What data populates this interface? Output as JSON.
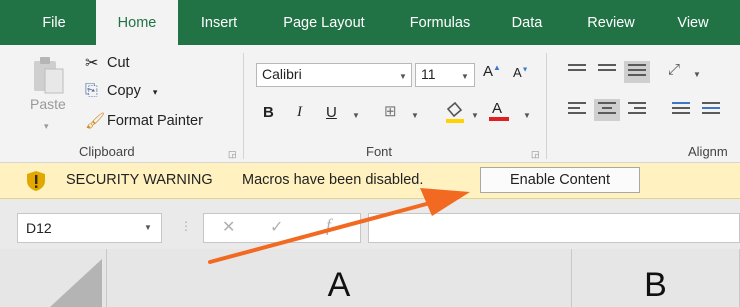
{
  "ribbon_tabs": [
    {
      "label": "File",
      "active": false
    },
    {
      "label": "Home",
      "active": true
    },
    {
      "label": "Insert",
      "active": false
    },
    {
      "label": "Page Layout",
      "active": false
    },
    {
      "label": "Formulas",
      "active": false
    },
    {
      "label": "Data",
      "active": false
    },
    {
      "label": "Review",
      "active": false
    },
    {
      "label": "View",
      "active": false
    }
  ],
  "clipboard": {
    "paste_label": "Paste",
    "cut_label": "Cut",
    "copy_label": "Copy",
    "format_painter_label": "Format Painter",
    "group_label": "Clipboard"
  },
  "font": {
    "font_name": "Calibri",
    "font_size": "11",
    "bold": "B",
    "italic": "I",
    "underline": "U",
    "font_color_glyph": "A",
    "grow_font_glyph": "A",
    "shrink_font_glyph": "A",
    "group_label": "Font"
  },
  "alignment": {
    "group_label": "Alignm"
  },
  "security_bar": {
    "title": "SECURITY WARNING",
    "message": "Macros have been disabled.",
    "button_label": "Enable Content",
    "icon": "warning-shield-icon"
  },
  "formula_bar": {
    "name_box_value": "D12",
    "cancel_glyph": "✕",
    "enter_glyph": "✓",
    "function_glyph": "f",
    "formula_value": ""
  },
  "columns": [
    "A",
    "B"
  ],
  "colors": {
    "ribbon_green": "#217346",
    "warning_bar": "#fff2c0",
    "annotation_arrow": "#f26a21"
  }
}
